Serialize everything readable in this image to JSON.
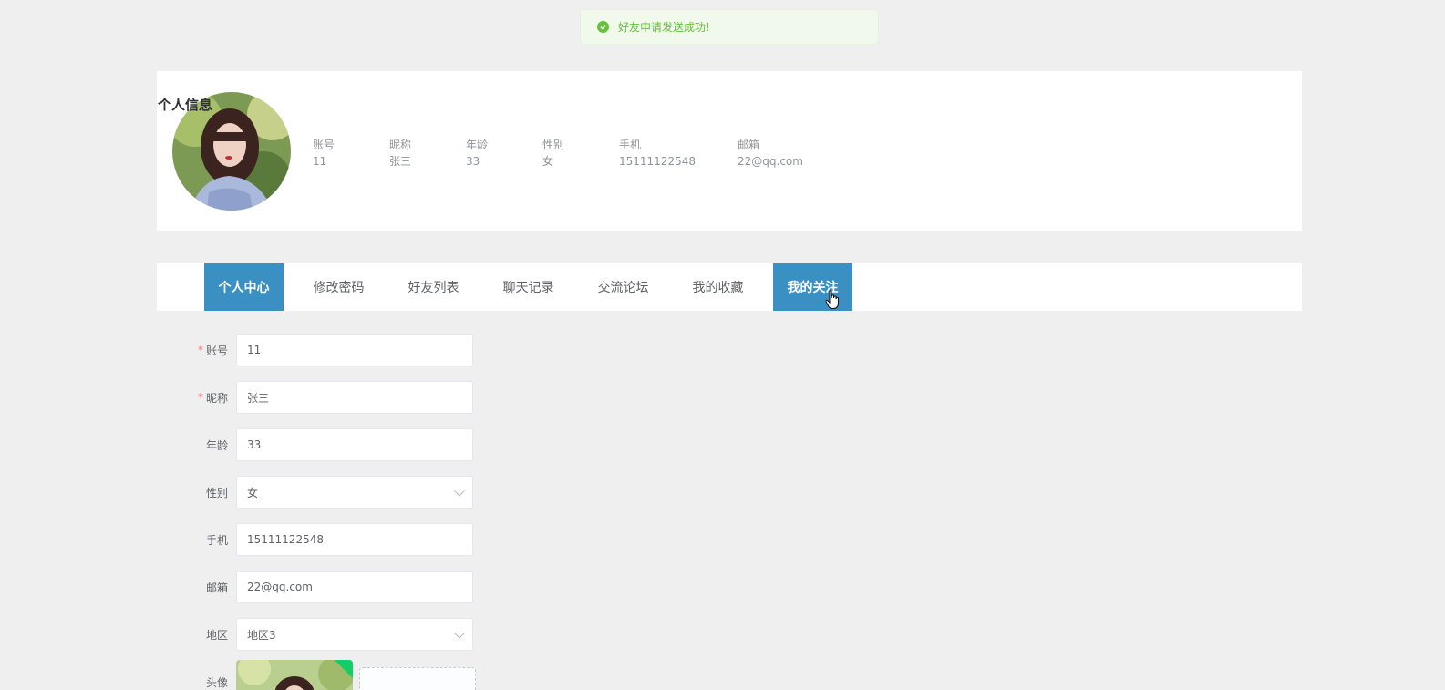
{
  "toast": {
    "message": "好友申请发送成功!"
  },
  "profile": {
    "title": "个人信息",
    "fields": [
      {
        "label": "账号",
        "value": "11"
      },
      {
        "label": "昵称",
        "value": "张三"
      },
      {
        "label": "年龄",
        "value": "33"
      },
      {
        "label": "性别",
        "value": "女"
      },
      {
        "label": "手机",
        "value": "15111122548"
      },
      {
        "label": "邮箱",
        "value": "22@qq.com"
      }
    ]
  },
  "tabs": [
    {
      "label": "个人中心",
      "active": true
    },
    {
      "label": "修改密码"
    },
    {
      "label": "好友列表"
    },
    {
      "label": "聊天记录"
    },
    {
      "label": "交流论坛"
    },
    {
      "label": "我的收藏"
    },
    {
      "label": "我的关注",
      "hover": true
    }
  ],
  "form": {
    "account": {
      "label": "账号",
      "value": "11",
      "required": true
    },
    "nickname": {
      "label": "昵称",
      "value": "张三",
      "required": true
    },
    "age": {
      "label": "年龄",
      "value": "33"
    },
    "gender": {
      "label": "性别",
      "value": "女"
    },
    "phone": {
      "label": "手机",
      "value": "15111122548"
    },
    "email": {
      "label": "邮箱",
      "value": "22@qq.com"
    },
    "region": {
      "label": "地区",
      "value": "地区3"
    },
    "avatar": {
      "label": "头像"
    }
  },
  "colors": {
    "accent": "#3a8fc3",
    "success": "#67c23a",
    "required": "#f56c6c"
  }
}
